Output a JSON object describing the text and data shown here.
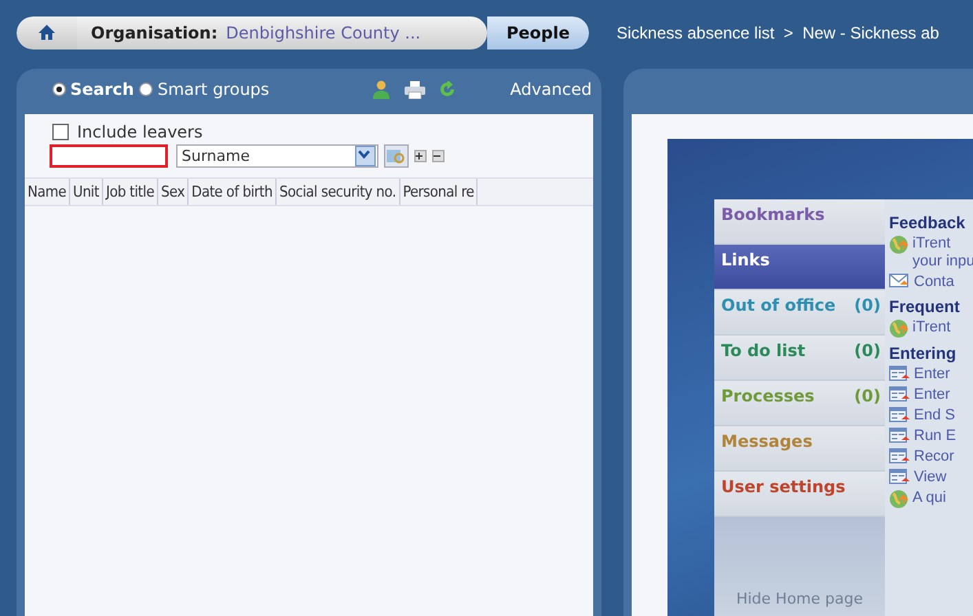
{
  "breadcrumb": {
    "organisation_label": "Organisation:",
    "organisation": "Denbighshire County ...",
    "section": "People",
    "trail": "Sickness absence list  >  New - Sickness ab"
  },
  "search_panel": {
    "modes": [
      {
        "label": "Search",
        "selected": true
      },
      {
        "label": "Smart groups",
        "selected": false
      }
    ],
    "advanced": "Advanced",
    "include_leavers": {
      "label": "Include leavers",
      "checked": false
    },
    "search_field": {
      "highlighted": true
    },
    "search_by": "Surname",
    "columns": [
      "Name",
      "Unit",
      "Job title",
      "Sex",
      "Date of birth",
      "Social security no.",
      "Personal re"
    ]
  },
  "home": {
    "menu": [
      {
        "label": "Bookmarks",
        "color": "#7a5ca8",
        "selected": false
      },
      {
        "label": "Links",
        "color": "#ffffff",
        "selected": true
      },
      {
        "label": "Out of office",
        "count": "(0)",
        "color": "#2e8fb0",
        "selected": false
      },
      {
        "label": "To do list",
        "count": "(0)",
        "color": "#2c8a5a",
        "selected": false
      },
      {
        "label": "Processes",
        "count": "(0)",
        "color": "#6f9a3a",
        "selected": false
      },
      {
        "label": "Messages",
        "color": "#b0843a",
        "selected": false
      },
      {
        "label": "User settings",
        "color": "#c0442c",
        "selected": false
      }
    ],
    "hide_link": "Hide Home page",
    "sections": [
      {
        "heading": "Feedback",
        "items": [
          {
            "kind": "globe",
            "lines": [
              "iTrent",
              "your inpu"
            ]
          },
          {
            "kind": "mail",
            "lines": [
              "Conta"
            ]
          }
        ]
      },
      {
        "heading": "Frequent",
        "items": [
          {
            "kind": "globe",
            "lines": [
              "iTrent"
            ]
          }
        ]
      },
      {
        "heading": "Entering",
        "items": [
          {
            "kind": "form",
            "lines": [
              "Enter"
            ]
          },
          {
            "kind": "form",
            "lines": [
              "Enter"
            ]
          },
          {
            "kind": "form",
            "lines": [
              "End S"
            ]
          },
          {
            "kind": "form",
            "lines": [
              "Run E"
            ]
          },
          {
            "kind": "form",
            "lines": [
              "Recor"
            ]
          },
          {
            "kind": "form",
            "lines": [
              "View"
            ]
          },
          {
            "kind": "globe",
            "lines": [
              "A qui"
            ]
          }
        ]
      }
    ]
  }
}
